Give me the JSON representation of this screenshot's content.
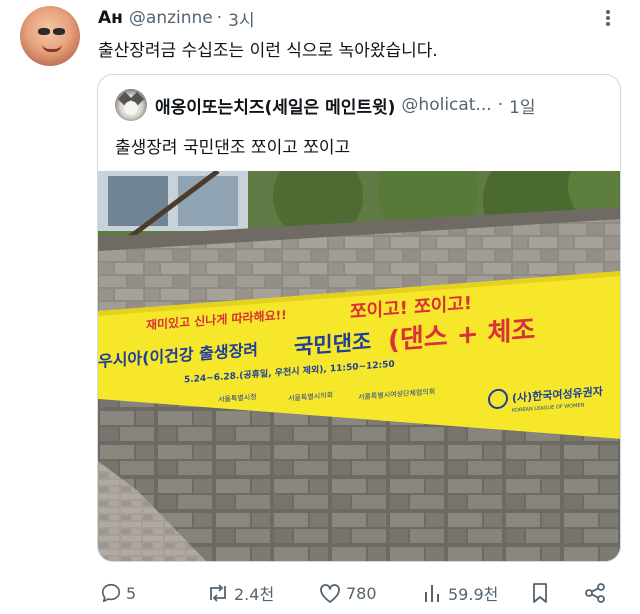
{
  "author": {
    "display_name": "Ан",
    "handle": "@anzinne",
    "dot": "·",
    "time": "3시"
  },
  "tweet": {
    "text": "출산장려금 수십조는 이런 식으로 녹아왔습니다."
  },
  "quote": {
    "display_name": "애옹이또는치즈(세일은 메인트윗)",
    "handle": "@holicat...",
    "dot": "·",
    "time": "1일",
    "text": "출생장려 국민댄조 쪼이고 쪼이고"
  },
  "banner": {
    "slogan": "재미있고 신나게 따라해요!! 쪼이고! 쪼이고!",
    "headline_left": "우시아(이건강 출생장려 ",
    "headline_bold": "국민댄조",
    "headline_red": "(댄스 + 체조",
    "schedule": "5.24~6.28.(공휴일, 우천시 제외), 11:50~12:50",
    "org_left": "서울특별시청",
    "org_mid": "서울특별시의회",
    "org_mid2": "서울특별시여성단체협의회",
    "org_right": "(사)한국여성유권자",
    "org_right_en": "KOREAN LEAGUE OF WOMEN"
  },
  "actions": {
    "reply_count": "5",
    "repost_count": "2.4천",
    "like_count": "780",
    "views_count": "59.9천"
  },
  "colors": {
    "text": "#0f1419",
    "secondary": "#536471",
    "border": "#cfd9de",
    "banner_yellow": "#f6e72a",
    "banner_red": "#d9303a",
    "banner_blue": "#1f3f9a"
  }
}
